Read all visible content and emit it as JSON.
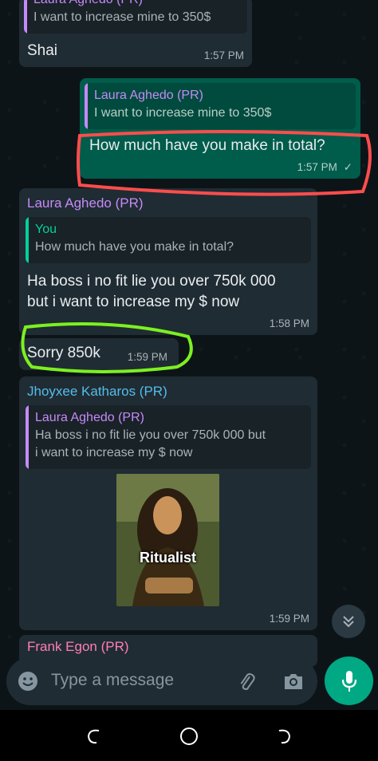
{
  "messages": {
    "m1": {
      "quote_author": "Laura Aghedo (PR)",
      "quote_text": "I want to increase mine to 350$",
      "text": "Shai",
      "time": "1:57 PM"
    },
    "m2": {
      "quote_author": "Laura Aghedo (PR)",
      "quote_text": "I want to increase mine to 350$",
      "text": "How much have you make in total?",
      "time": "1:57 PM",
      "status": "✓"
    },
    "m3": {
      "sender": "Laura Aghedo (PR)",
      "quote_author": "You",
      "quote_text": "How much have you make in total?",
      "text_line1": "Ha boss i no fit lie you over 750k 000",
      "text_line2": "but i want to increase my $ now",
      "time": "1:58 PM"
    },
    "m4": {
      "text": "Sorry 850k",
      "time": "1:59 PM"
    },
    "m5": {
      "sender": "Jhoyxee Katharos (PR)",
      "quote_author": "Laura Aghedo (PR)",
      "quote_text_line1": "Ha boss i no fit lie you over 750k 000 but",
      "quote_text_line2": "i want to increase my $ now",
      "image_caption": "Ritualist",
      "time": "1:59 PM"
    },
    "m6": {
      "sender": "Frank Egon (PR)"
    }
  },
  "composer": {
    "placeholder": "Type a message"
  },
  "colors": {
    "incoming": "#202c33",
    "outgoing": "#005c4b",
    "sender_purple": "#c58af9",
    "sender_teal": "#53bdeb",
    "you_green": "#06cf9c",
    "sender_pink": "#ff7eb6",
    "annotation_red": "#ff4d4d",
    "annotation_green": "#7cf021",
    "mic_button": "#00a884"
  },
  "icons": [
    "emoji-icon",
    "attach-icon",
    "camera-icon",
    "mic-icon",
    "chevron-double-down-icon",
    "nav-recent-icon",
    "nav-home-icon",
    "nav-back-icon"
  ]
}
